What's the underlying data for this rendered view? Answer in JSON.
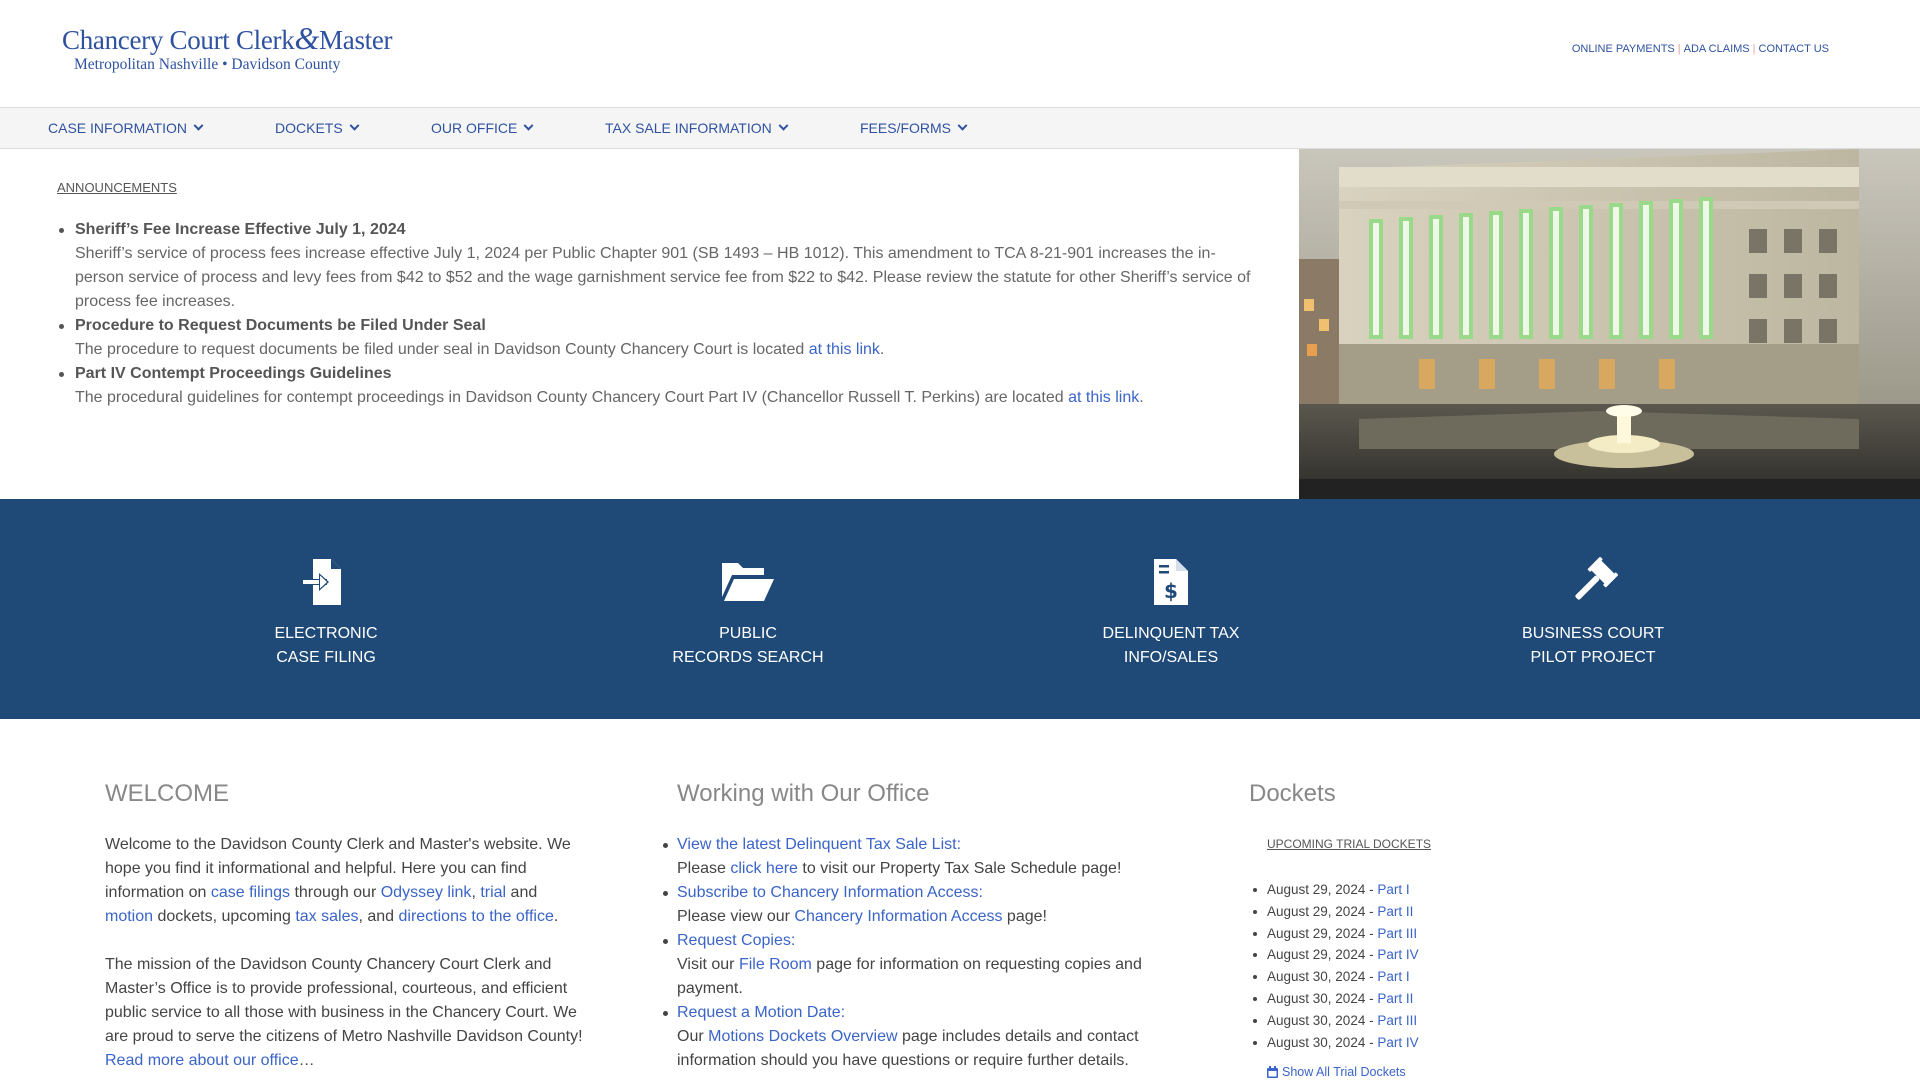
{
  "header": {
    "logo_line1_a": "Chancery Court Clerk",
    "logo_amp": "&",
    "logo_line1_b": "Master",
    "logo_line2": "Metropolitan Nashville • Davidson County",
    "links": [
      "ONLINE PAYMENTS",
      "ADA CLAIMS",
      "CONTACT US"
    ]
  },
  "nav": {
    "items": [
      "CASE INFORMATION",
      "DOCKETS",
      "OUR OFFICE",
      "TAX SALE INFORMATION",
      "FEES/FORMS"
    ]
  },
  "announcements": {
    "title": "ANNOUNCEMENTS",
    "items": [
      {
        "heading": "Sheriff’s Fee Increase Effective July 1, 2024",
        "body": "Sheriff’s service of process fees increase effective July 1, 2024 per Public Chapter 901 (SB 1493 – HB 1012). This amendment to TCA 8-21-901 increases the in-person service of process and levy fees from $42 to $52 and the wage garnishment service fee from $22 to $42. Please review the statute for other Sheriff’s service of process fee increases.",
        "link": "",
        "after": ""
      },
      {
        "heading": "Procedure to Request Documents be Filed Under Seal",
        "body": "The procedure to request documents be filed under seal in Davidson County Chancery Court is located ",
        "link": "at this link",
        "after": "."
      },
      {
        "heading": "Part IV Contempt Proceedings Guidelines",
        "body": "The procedural guidelines for contempt proceedings in Davidson County Chancery Court Part IV (Chancellor Russell T. Perkins) are located ",
        "link": "at this link",
        "after": "."
      }
    ]
  },
  "tiles": [
    {
      "line1": "ELECTRONIC",
      "line2": "CASE FILING",
      "icon": "file-import-icon"
    },
    {
      "line1": "PUBLIC",
      "line2": "RECORDS SEARCH",
      "icon": "folder-open-icon"
    },
    {
      "line1": "DELINQUENT TAX",
      "line2": "INFO/SALES",
      "icon": "file-invoice-dollar-icon"
    },
    {
      "line1": "BUSINESS COURT",
      "line2": "PILOT PROJECT",
      "icon": "gavel-icon"
    }
  ],
  "welcome": {
    "title": "WELCOME",
    "p1_a": "Welcome to the Davidson County Clerk and Master's website. We hope you find it informational and helpful. Here you can find information on ",
    "link_case_filings": "case filings",
    "p1_b": " through our ",
    "link_odyssey": "Odyssey link",
    "p1_c": ", ",
    "link_trial": "trial",
    "p1_d": " and ",
    "link_motion": "motion",
    "p1_e": " dockets, upcoming ",
    "link_tax_sales": "tax sales",
    "p1_f": ", and ",
    "link_directions": "directions to the office",
    "p1_g": ".",
    "p2": "The mission of the Davidson County Chancery Court Clerk and Master’s Office is to provide professional, courteous, and efficient public service to all those with business in the Chancery Court. We are proud to serve the citizens of Metro Nashville Davidson County! ",
    "read_more": "Read more about our office",
    "ellipsis": "…"
  },
  "working": {
    "title": "Working with Our Office",
    "items": [
      {
        "link": "View the latest Delinquent Tax Sale List:",
        "pre": "Please ",
        "inner_link": "click here",
        "post": " to visit our Property Tax Sale Schedule page!"
      },
      {
        "link": "Subscribe to Chancery Information Access:",
        "pre": "Please view our ",
        "inner_link": "Chancery Information Access",
        "post": " page!"
      },
      {
        "link": "Request Copies:",
        "pre": "Visit our ",
        "inner_link": "File Room",
        "post": " page for information on requesting copies and payment."
      },
      {
        "link": "Request a Motion Date:",
        "pre": "Our ",
        "inner_link": "Motions Dockets Overview",
        "post": " page includes details and contact information should you have questions or require further details."
      }
    ]
  },
  "dockets": {
    "title": "Dockets",
    "subtitle": "UPCOMING TRIAL DOCKETS",
    "items": [
      {
        "date": "August 29, 2024 - ",
        "part": "Part I"
      },
      {
        "date": "August 29, 2024 - ",
        "part": "Part II"
      },
      {
        "date": "August 29, 2024 - ",
        "part": "Part III"
      },
      {
        "date": "August 29, 2024 - ",
        "part": "Part IV"
      },
      {
        "date": "August 30, 2024 - ",
        "part": "Part I"
      },
      {
        "date": "August 30, 2024 - ",
        "part": "Part II"
      },
      {
        "date": "August 30, 2024 - ",
        "part": "Part III"
      },
      {
        "date": "August 30, 2024 - ",
        "part": "Part IV"
      }
    ],
    "show_all": "Show All Trial Dockets"
  }
}
